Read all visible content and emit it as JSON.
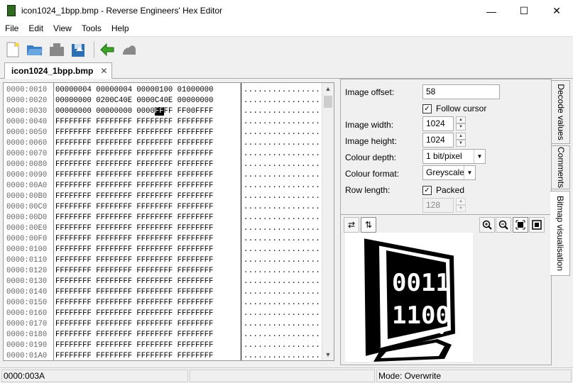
{
  "window": {
    "title": "icon1024_1bpp.bmp - Reverse Engineers' Hex Editor",
    "minimize": "—",
    "maximize": "☐",
    "close": "✕"
  },
  "menu": [
    "File",
    "Edit",
    "View",
    "Tools",
    "Help"
  ],
  "toolbar_icons": [
    "new-file-icon",
    "open-folder-icon",
    "save-icon",
    "save-as-icon",
    "back-arrow-icon",
    "forward-icon"
  ],
  "tab": {
    "label": "icon1024_1bpp.bmp",
    "close": "✕"
  },
  "hex": {
    "rows": [
      {
        "off": "0000:0010",
        "bytes": "00000004 00000004 00000100 01000000",
        "ascii": "................"
      },
      {
        "off": "0000:0020",
        "bytes": "00000000 0200C40E 0000C40E 00000000",
        "ascii": "................"
      },
      {
        "off": "0000:0030",
        "bytes": "00000000 00000000 0000",
        "sel": "FF",
        "after": "FF FF00FFFF",
        "ascii": "................"
      },
      {
        "off": "0000:0040",
        "bytes": "FFFFFFFF FFFFFFFF FFFFFFFF FFFFFFFF",
        "ascii": "................"
      },
      {
        "off": "0000:0050",
        "bytes": "FFFFFFFF FFFFFFFF FFFFFFFF FFFFFFFF",
        "ascii": "................"
      },
      {
        "off": "0000:0060",
        "bytes": "FFFFFFFF FFFFFFFF FFFFFFFF FFFFFFFF",
        "ascii": "................"
      },
      {
        "off": "0000:0070",
        "bytes": "FFFFFFFF FFFFFFFF FFFFFFFF FFFFFFFF",
        "ascii": "................"
      },
      {
        "off": "0000:0080",
        "bytes": "FFFFFFFF FFFFFFFF FFFFFFFF FFFFFFFF",
        "ascii": "................"
      },
      {
        "off": "0000:0090",
        "bytes": "FFFFFFFF FFFFFFFF FFFFFFFF FFFFFFFF",
        "ascii": "................"
      },
      {
        "off": "0000:00A0",
        "bytes": "FFFFFFFF FFFFFFFF FFFFFFFF FFFFFFFF",
        "ascii": "................"
      },
      {
        "off": "0000:00B0",
        "bytes": "FFFFFFFF FFFFFFFF FFFFFFFF FFFFFFFF",
        "ascii": "................"
      },
      {
        "off": "0000:00C0",
        "bytes": "FFFFFFFF FFFFFFFF FFFFFFFF FFFFFFFF",
        "ascii": "................"
      },
      {
        "off": "0000:00D0",
        "bytes": "FFFFFFFF FFFFFFFF FFFFFFFF FFFFFFFF",
        "ascii": "................"
      },
      {
        "off": "0000:00E0",
        "bytes": "FFFFFFFF FFFFFFFF FFFFFFFF FFFFFFFF",
        "ascii": "................"
      },
      {
        "off": "0000:00F0",
        "bytes": "FFFFFFFF FFFFFFFF FFFFFFFF FFFFFFFF",
        "ascii": "................"
      },
      {
        "off": "0000:0100",
        "bytes": "FFFFFFFF FFFFFFFF FFFFFFFF FFFFFFFF",
        "ascii": "................"
      },
      {
        "off": "0000:0110",
        "bytes": "FFFFFFFF FFFFFFFF FFFFFFFF FFFFFFFF",
        "ascii": "................"
      },
      {
        "off": "0000:0120",
        "bytes": "FFFFFFFF FFFFFFFF FFFFFFFF FFFFFFFF",
        "ascii": "................"
      },
      {
        "off": "0000:0130",
        "bytes": "FFFFFFFF FFFFFFFF FFFFFFFF FFFFFFFF",
        "ascii": "................"
      },
      {
        "off": "0000:0140",
        "bytes": "FFFFFFFF FFFFFFFF FFFFFFFF FFFFFFFF",
        "ascii": "................"
      },
      {
        "off": "0000:0150",
        "bytes": "FFFFFFFF FFFFFFFF FFFFFFFF FFFFFFFF",
        "ascii": "................"
      },
      {
        "off": "0000:0160",
        "bytes": "FFFFFFFF FFFFFFFF FFFFFFFF FFFFFFFF",
        "ascii": "................"
      },
      {
        "off": "0000:0170",
        "bytes": "FFFFFFFF FFFFFFFF FFFFFFFF FFFFFFFF",
        "ascii": "................"
      },
      {
        "off": "0000:0180",
        "bytes": "FFFFFFFF FFFFFFFF FFFFFFFF FFFFFFFF",
        "ascii": "................"
      },
      {
        "off": "0000:0190",
        "bytes": "FFFFFFFF FFFFFFFF FFFFFFFF FFFFFFFF",
        "ascii": "................"
      },
      {
        "off": "0000:01A0",
        "bytes": "FFFFFFFF FFFFFFFF FFFFFFFF FFFFFFFF",
        "ascii": "................"
      }
    ]
  },
  "panel": {
    "image_offset_label": "Image offset:",
    "image_offset_value": "58",
    "follow_cursor_label": "Follow cursor",
    "follow_cursor_checked": true,
    "image_width_label": "Image width:",
    "image_width_value": "1024",
    "image_height_label": "Image height:",
    "image_height_value": "1024",
    "colour_depth_label": "Colour depth:",
    "colour_depth_value": "1 bit/pixel",
    "colour_format_label": "Colour format:",
    "colour_format_value": "Greyscale",
    "row_length_label": "Row length:",
    "packed_label": "Packed",
    "packed_checked": true,
    "row_length_value": "128",
    "bitmap_text_top": "0011",
    "bitmap_text_bottom": "1100"
  },
  "side_tabs": [
    "Decode values",
    "Comments",
    "Bitmap visualisation"
  ],
  "status": {
    "offset": "0000:003A",
    "middle": "",
    "mode": "Mode: Overwrite"
  }
}
